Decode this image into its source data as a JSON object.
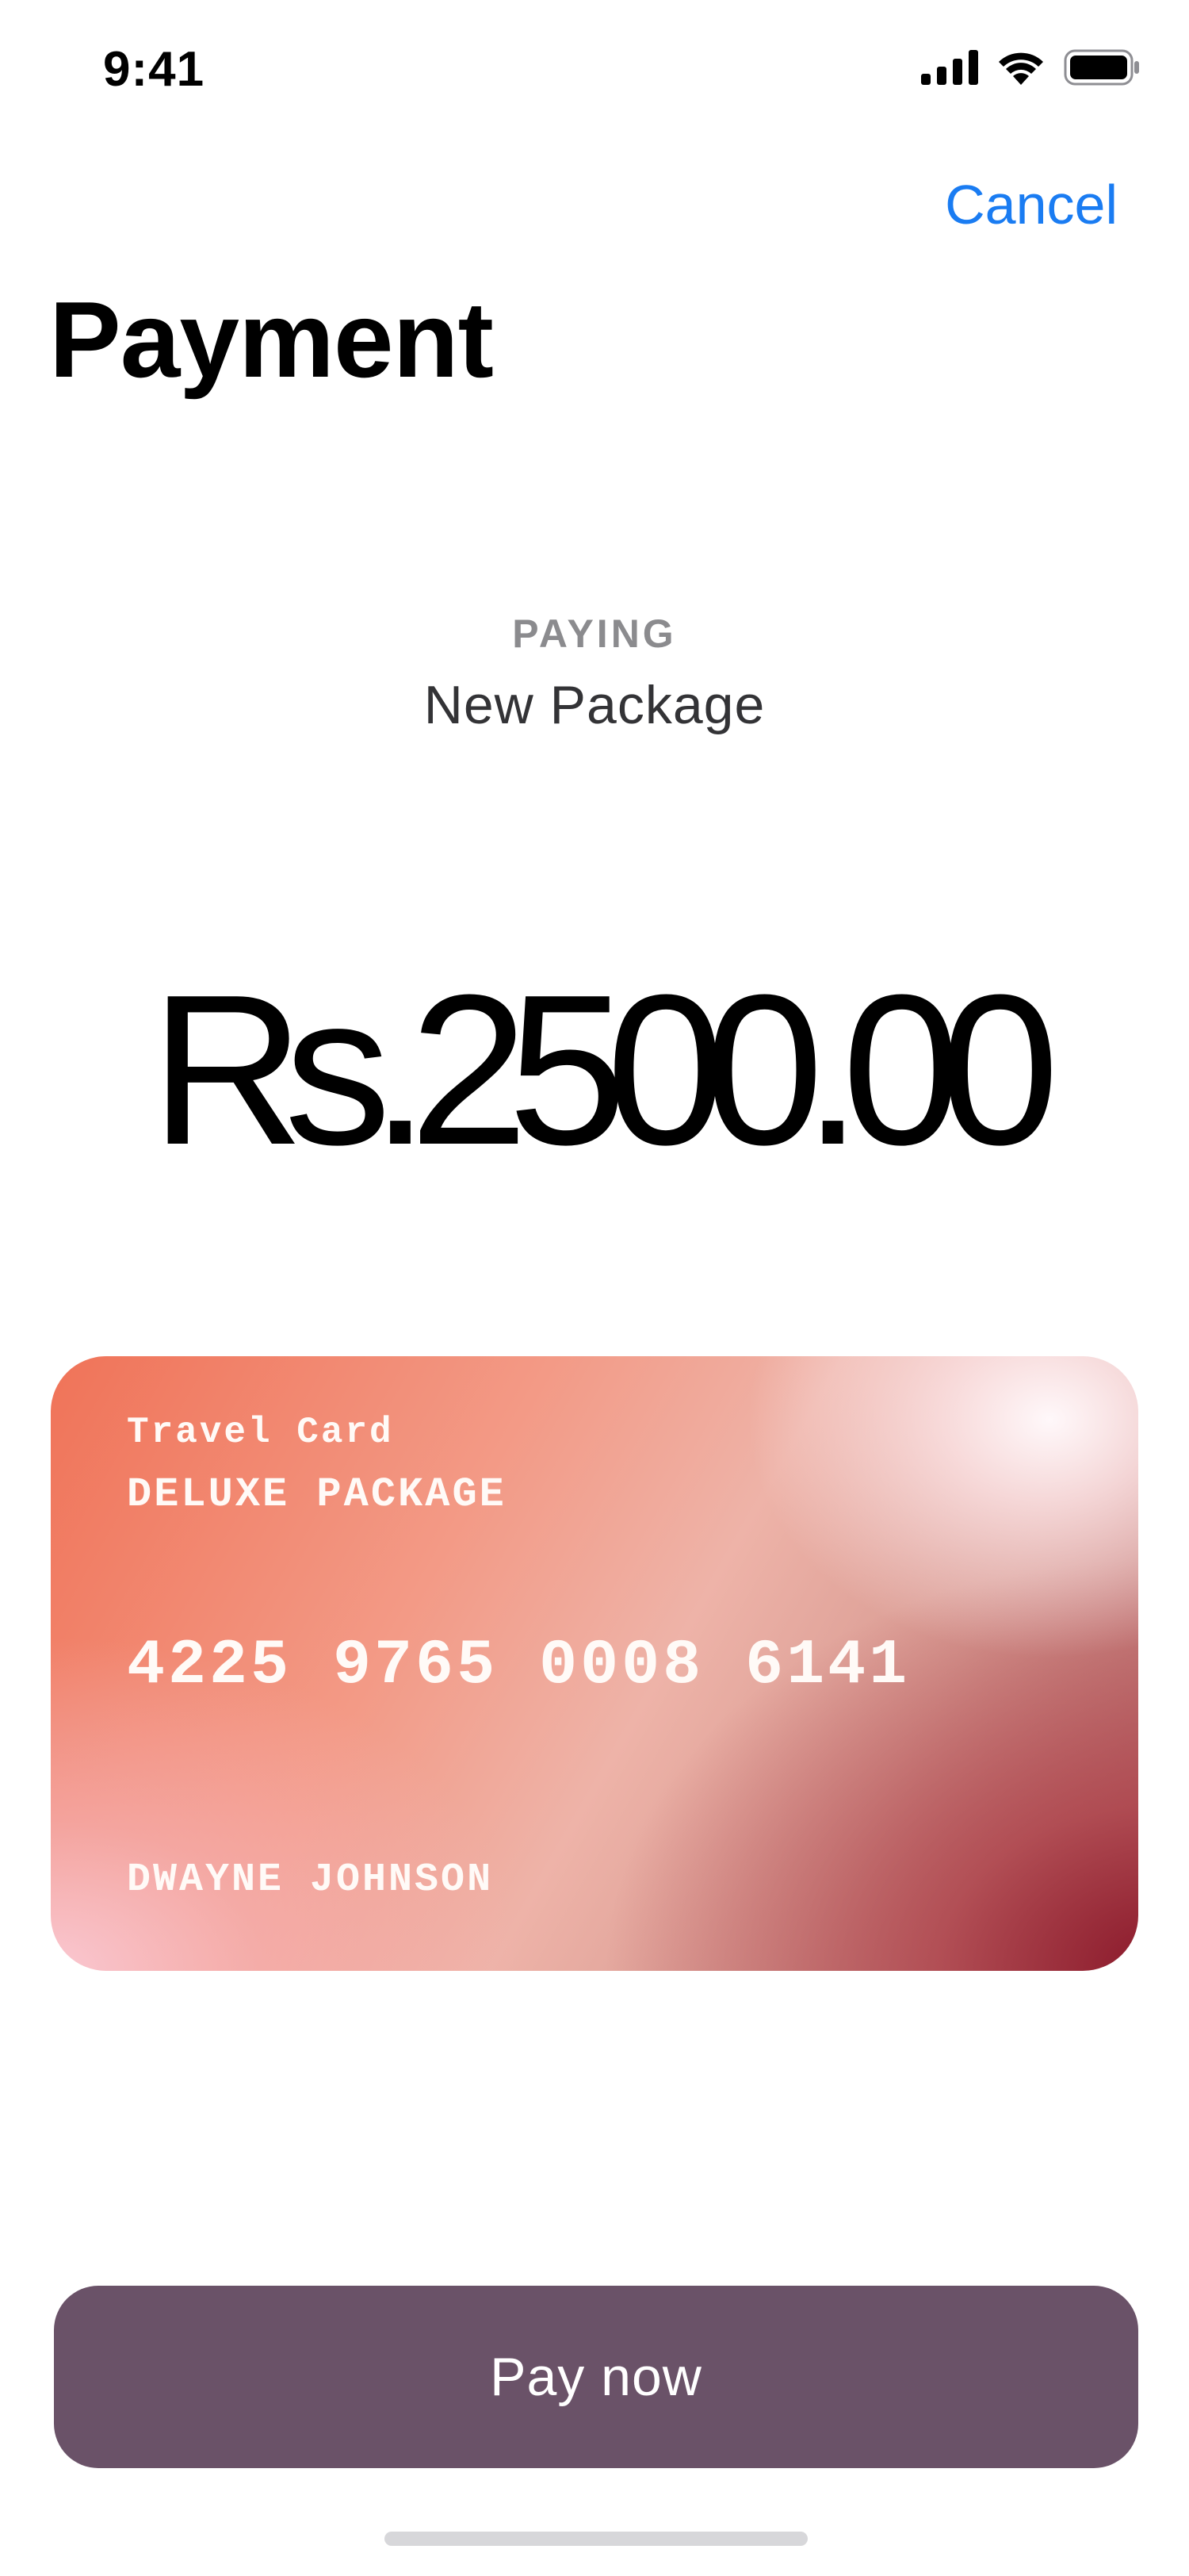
{
  "status_bar": {
    "time": "9:41",
    "icons": [
      "cellular-signal-icon",
      "wifi-icon",
      "battery-icon"
    ]
  },
  "header": {
    "cancel_label": "Cancel",
    "title": "Payment"
  },
  "paying": {
    "caption": "PAYING",
    "item": "New Package"
  },
  "amount": "Rs.2500.00",
  "card": {
    "brand": "Travel Card",
    "tier": "DELUXE PACKAGE",
    "number": "4225 9765 0008 6141",
    "holder": "DWAYNE JOHNSON"
  },
  "actions": {
    "pay_label": "Pay now"
  },
  "colors": {
    "accent": "#1a7cf2",
    "button": "#6a5268",
    "caption": "#8b8b8e"
  }
}
